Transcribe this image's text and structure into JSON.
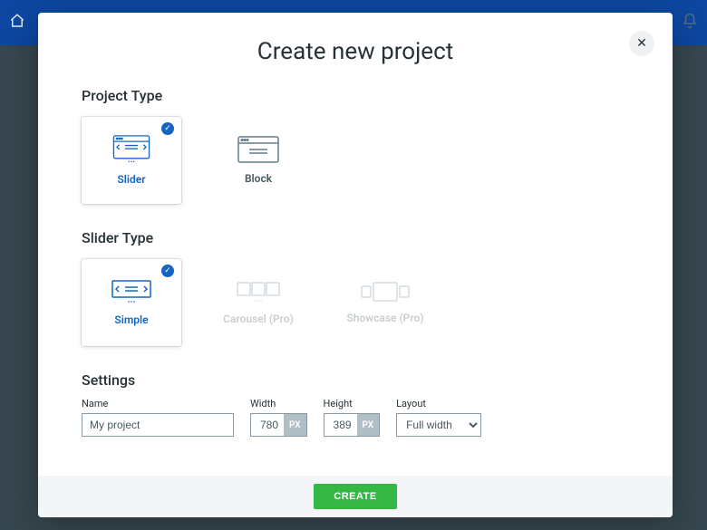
{
  "modal": {
    "title": "Create new project",
    "close": "✕"
  },
  "sections": {
    "project_type": "Project Type",
    "slider_type": "Slider Type",
    "settings": "Settings"
  },
  "project_types": [
    {
      "key": "slider",
      "label": "Slider",
      "selected": true
    },
    {
      "key": "block",
      "label": "Block",
      "selected": false
    }
  ],
  "slider_types": [
    {
      "key": "simple",
      "label": "Simple",
      "selected": true,
      "disabled": false
    },
    {
      "key": "carousel",
      "label": "Carousel (Pro)",
      "selected": false,
      "disabled": true
    },
    {
      "key": "showcase",
      "label": "Showcase (Pro)",
      "selected": false,
      "disabled": true
    }
  ],
  "settings_fields": {
    "name_label": "Name",
    "name_value": "My project",
    "width_label": "Width",
    "width_value": "780",
    "height_label": "Height",
    "height_value": "389",
    "unit": "PX",
    "layout_label": "Layout",
    "layout_value": "Full width"
  },
  "actions": {
    "create": "CREATE"
  }
}
